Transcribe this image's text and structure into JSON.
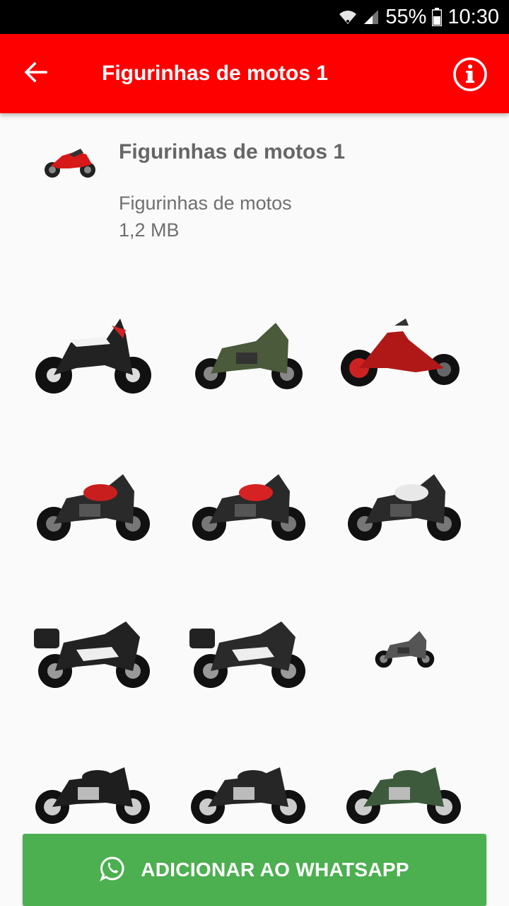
{
  "status_bar": {
    "battery": "55%",
    "time": "10:30",
    "icons": [
      "wifi-icon",
      "signal-icon",
      "battery-icon"
    ]
  },
  "app_bar": {
    "title": "Figurinhas de motos 1",
    "back_icon": "arrow-back-icon",
    "info_icon": "info-icon",
    "color": "#ff0000"
  },
  "pack": {
    "name": "Figurinhas de motos 1",
    "publisher": "Figurinhas de motos",
    "size": "1,2 MB"
  },
  "stickers": [
    {
      "name": "dirt-bike-sticker",
      "color": "#d32020",
      "style": "dirt"
    },
    {
      "name": "adventure-bike-green-sticker",
      "color": "#4a5a3a",
      "style": "adventure"
    },
    {
      "name": "chopper-sticker",
      "color": "#b01818",
      "style": "chopper"
    },
    {
      "name": "scrambler-red-sticker",
      "color": "#c81e1e",
      "style": "naked"
    },
    {
      "name": "naked-red-sticker",
      "color": "#d62222",
      "style": "naked"
    },
    {
      "name": "naked-white-sticker",
      "color": "#e8e8e8",
      "style": "naked"
    },
    {
      "name": "touring-black-sticker",
      "color": "#222222",
      "style": "touring"
    },
    {
      "name": "touring-black-2-sticker",
      "color": "#2a2a2a",
      "style": "touring"
    },
    {
      "name": "adventure-small-sticker",
      "color": "#555555",
      "style": "adventure"
    },
    {
      "name": "classic-black-sticker",
      "color": "#1e1e1e",
      "style": "classic"
    },
    {
      "name": "classic-black-2-sticker",
      "color": "#262626",
      "style": "classic"
    },
    {
      "name": "classic-green-sticker",
      "color": "#3d5a3d",
      "style": "classic"
    }
  ],
  "cta": {
    "label": "ADICIONAR AO WHATSAPP",
    "icon": "whatsapp-icon",
    "color": "#4caf50"
  }
}
